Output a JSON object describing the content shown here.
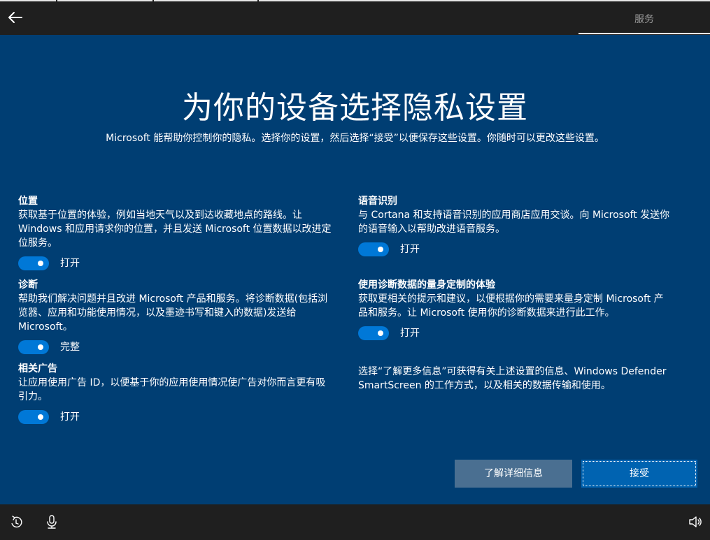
{
  "topbar": {
    "step_label": "服务",
    "back_icon": "back-arrow-icon"
  },
  "heading": {
    "title": "为你的设备选择隐私设置",
    "subtitle": "Microsoft 能帮助你控制你的隐私。选择你的设置，然后选择“接受”以便保存这些设置。你随时可以更改这些设置。"
  },
  "settings": {
    "location": {
      "name": "位置",
      "desc_lines": [
        "获取基于位置的体验，例如当地天气以及到达收藏地点的路线。让",
        "Windows 和应用请求你的位置，并且发送 Microsoft 位置数据以改进定",
        "位服务。"
      ],
      "toggle_state": "on",
      "toggle_label": "打开"
    },
    "diagnostics": {
      "name": "诊断",
      "desc_lines": [
        "帮助我们解决问题并且改进 Microsoft 产品和服务。将诊断数据(包括浏",
        "览器、应用和功能使用情况，以及墨迹书写和键入的数据)发送给",
        "Microsoft。"
      ],
      "toggle_state": "on",
      "toggle_label": "完整"
    },
    "ads": {
      "name": "相关广告",
      "desc_lines": [
        "让应用使用广告 ID，以便基于你的应用使用情况使广告对你而言更有吸",
        "引力。"
      ],
      "toggle_state": "on",
      "toggle_label": "打开"
    },
    "speech": {
      "name": "语音识别",
      "desc_lines": [
        "与 Cortana 和支持语音识别的应用商店应用交谈。向 Microsoft 发送你",
        "的语音输入以帮助改进语音服务。"
      ],
      "toggle_state": "on",
      "toggle_label": "打开"
    },
    "tailored": {
      "name": "使用诊断数据的量身定制的体验",
      "desc_lines": [
        "获取更相关的提示和建议，以便根据你的需要来量身定制 Microsoft 产",
        "品和服务。让 Microsoft 使用你的诊断数据来进行此工作。"
      ],
      "toggle_state": "on",
      "toggle_label": "打开"
    }
  },
  "info_note": {
    "lines": [
      "选择“了解更多信息”可获得有关上述设置的信息、Windows Defender",
      "SmartScreen 的工作方式，以及相关的数据传输和使用。"
    ]
  },
  "buttons": {
    "learn_more": "了解详细信息",
    "accept": "接受"
  },
  "bottombar": {
    "icons": [
      "ease-of-access-icon",
      "microphone-icon",
      "volume-icon"
    ]
  },
  "colors": {
    "background": "#003e73",
    "toggle_on": "#0078d7",
    "accept_button": "#0063b1",
    "learn_more_button": "#4a6f91",
    "bar": "#1f1f1f"
  }
}
